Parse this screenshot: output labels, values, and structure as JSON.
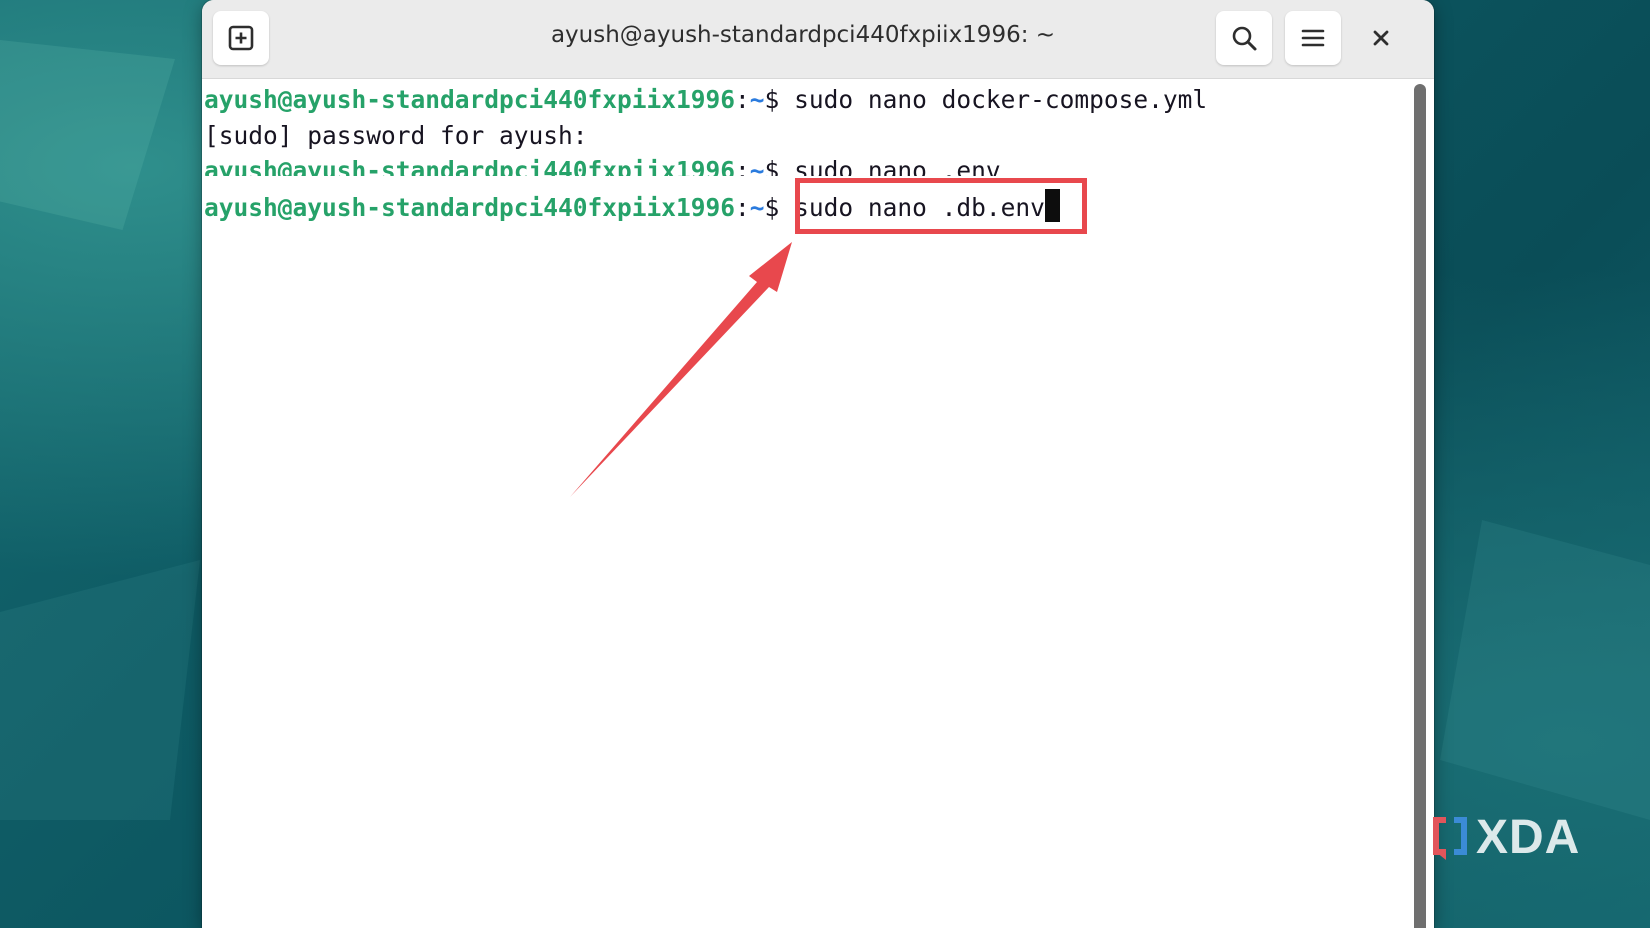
{
  "window": {
    "title": "ayush@ayush-standardpci440fxpiix1996: ~"
  },
  "icons": {
    "new_tab": "new-tab-icon",
    "search": "search-icon",
    "menu": "hamburger-menu-icon",
    "close": "close-icon"
  },
  "terminal": {
    "prompt_user": "ayush@ayush-standardpci440fxpiix1996",
    "prompt_path": "~",
    "prompt_sep": ":",
    "prompt_symbol": "$",
    "lines": [
      {
        "type": "prompt",
        "command": "sudo nano docker-compose.yml"
      },
      {
        "type": "output",
        "text": "[sudo] password for ayush:"
      },
      {
        "type": "prompt",
        "command": "sudo nano .env"
      },
      {
        "type": "prompt",
        "command": "sudo nano .db.env"
      }
    ]
  },
  "annotation": {
    "highlight_color": "#e8484d"
  },
  "watermark": {
    "text": "XDA"
  },
  "colors": {
    "prompt_user": "#26a269",
    "prompt_path": "#2a7bde",
    "titlebar": "#ebebeb",
    "desktop": "#0f5a63"
  }
}
